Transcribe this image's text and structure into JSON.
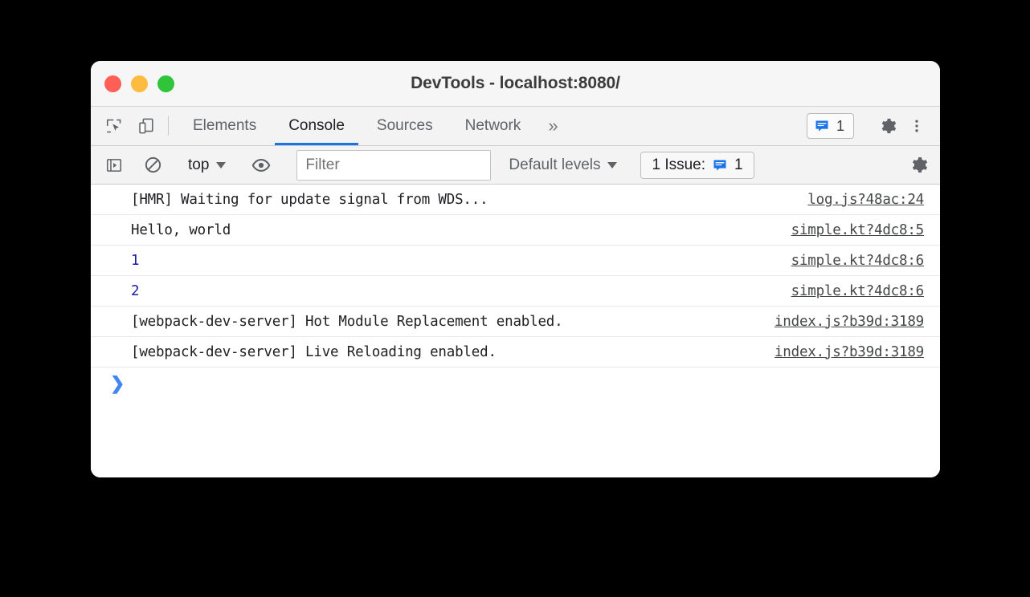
{
  "window": {
    "title": "DevTools - localhost:8080/",
    "traffic_lights": [
      {
        "name": "close",
        "color": "#ff5f57"
      },
      {
        "name": "minimize",
        "color": "#fdbc40"
      },
      {
        "name": "maximize",
        "color": "#2fc43a"
      }
    ]
  },
  "tabbar": {
    "icons": [
      {
        "name": "inspect-element-icon"
      },
      {
        "name": "device-toolbar-icon"
      }
    ],
    "tabs": [
      {
        "label": "Elements",
        "active": false
      },
      {
        "label": "Console",
        "active": true
      },
      {
        "label": "Sources",
        "active": false
      },
      {
        "label": "Network",
        "active": false
      }
    ],
    "more_label": "»",
    "issues_badge": {
      "icon": "issues-message-icon",
      "count": "1"
    },
    "settings_icon": "gear-icon",
    "menu_icon": "more-vertical-icon"
  },
  "console_toolbar": {
    "sidebar_toggle_icon": "console-sidebar-icon",
    "clear_icon": "clear-console-icon",
    "context": {
      "label": "top"
    },
    "eye_icon": "live-expression-eye-icon",
    "filter": {
      "placeholder": "Filter",
      "value": ""
    },
    "levels": {
      "label": "Default levels"
    },
    "issues": {
      "label": "1 Issue:",
      "icon": "issues-message-icon",
      "count": "1"
    },
    "settings_icon": "gear-icon"
  },
  "console": {
    "rows": [
      {
        "text": "[HMR] Waiting for update signal from WDS...",
        "type": "text",
        "source": "log.js?48ac:24"
      },
      {
        "text": "Hello, world",
        "type": "text",
        "source": "simple.kt?4dc8:5"
      },
      {
        "text": "1",
        "type": "number",
        "source": "simple.kt?4dc8:6"
      },
      {
        "text": "2",
        "type": "number",
        "source": "simple.kt?4dc8:6"
      },
      {
        "text": "[webpack-dev-server] Hot Module Replacement enabled.",
        "type": "text",
        "source": "index.js?b39d:3189"
      },
      {
        "text": "[webpack-dev-server] Live Reloading enabled.",
        "type": "text",
        "source": "index.js?b39d:3189"
      }
    ],
    "prompt_symbol": "❯"
  },
  "colors": {
    "accent": "#1a73e8",
    "prompt": "#4285f4",
    "number": "#1a1aa6",
    "text": "#202124",
    "issue_icon": "#1a73e8"
  }
}
